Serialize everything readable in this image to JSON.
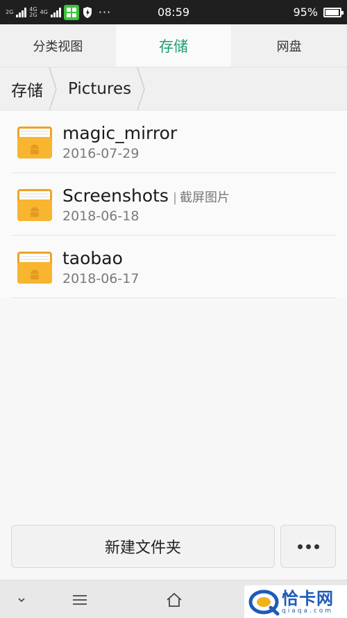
{
  "status_bar": {
    "network_1": "2G",
    "network_2_top": "4G",
    "network_2_bottom": "2G",
    "network_3": "4G",
    "more": "···",
    "time": "08:59",
    "battery": "95%",
    "battery_level": 0.95
  },
  "tabs": [
    {
      "label": "分类视图",
      "active": false
    },
    {
      "label": "存储",
      "active": true
    },
    {
      "label": "网盘",
      "active": false
    }
  ],
  "breadcrumb": [
    {
      "label": "存储"
    },
    {
      "label": "Pictures"
    }
  ],
  "files": [
    {
      "name": "magic_mirror",
      "alias": "",
      "date": "2016-07-29",
      "icon": "folder-icon"
    },
    {
      "name": "Screenshots",
      "alias": "截屏图片",
      "date": "2018-06-18",
      "icon": "folder-icon"
    },
    {
      "name": "taobao",
      "alias": "",
      "date": "2018-06-17",
      "icon": "folder-icon"
    }
  ],
  "actions": {
    "new_folder": "新建文件夹",
    "more_icon": "more-dots-icon"
  },
  "navbar": {
    "icons": [
      "chevron-down-icon",
      "menu-icon",
      "home-icon"
    ]
  },
  "watermark": {
    "cn": "恰卡网",
    "en": "qiaqa.com"
  },
  "colors": {
    "accent": "#1f9e6e",
    "folder": "#f6b42d"
  }
}
